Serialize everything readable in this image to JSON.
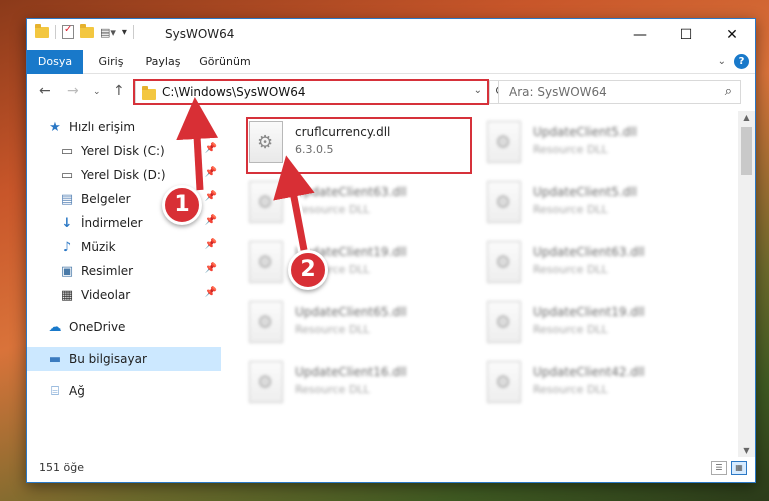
{
  "window": {
    "title": "SysWOW64",
    "minimize_label": "—",
    "maximize_label": "☐",
    "close_label": "✕"
  },
  "ribbon": {
    "tabs": [
      {
        "label": "Dosya"
      },
      {
        "label": "Giriş"
      },
      {
        "label": "Paylaş"
      },
      {
        "label": "Görünüm"
      }
    ]
  },
  "nav": {
    "address": "C:\\Windows\\SysWOW64",
    "search_placeholder": "Ara: SysWOW64"
  },
  "sidebar": {
    "items": [
      {
        "label": "Hızlı erişim",
        "icon": "star-icon"
      },
      {
        "label": "Yerel Disk (C:)",
        "icon": "drive-icon"
      },
      {
        "label": "Yerel Disk (D:)",
        "icon": "drive-icon"
      },
      {
        "label": "Belgeler",
        "icon": "documents-icon"
      },
      {
        "label": "İndirmeler",
        "icon": "download-icon"
      },
      {
        "label": "Müzik",
        "icon": "music-icon"
      },
      {
        "label": "Resimler",
        "icon": "pictures-icon"
      },
      {
        "label": "Videolar",
        "icon": "videos-icon"
      },
      {
        "label": "OneDrive",
        "icon": "cloud-icon"
      },
      {
        "label": "Bu bilgisayar",
        "icon": "computer-icon"
      },
      {
        "label": "Ağ",
        "icon": "network-icon"
      }
    ]
  },
  "files": [
    {
      "name": "cruflcurrency.dll",
      "type": "6.3.0.5"
    },
    {
      "name": "UpdateClient5.dll",
      "type": "Resource DLL"
    },
    {
      "name": "UpdateClient63.dll",
      "type": "Resource DLL"
    },
    {
      "name": "UpdateClient5.dll",
      "type": "Resource DLL"
    },
    {
      "name": "UpdateClient19.dll",
      "type": "Resource DLL"
    },
    {
      "name": "UpdateClient63.dll",
      "type": "Resource DLL"
    },
    {
      "name": "UpdateClient65.dll",
      "type": "Resource DLL"
    },
    {
      "name": "UpdateClient19.dll",
      "type": "Resource DLL"
    },
    {
      "name": "UpdateClient16.dll",
      "type": "Resource DLL"
    },
    {
      "name": "UpdateClient42.dll",
      "type": "Resource DLL"
    }
  ],
  "status": {
    "count": "151 öğe"
  },
  "annotations": {
    "badge1": "1",
    "badge2": "2"
  },
  "colors": {
    "accent": "#1979ca",
    "highlight": "#d6313a",
    "selection": "#cce8ff"
  }
}
